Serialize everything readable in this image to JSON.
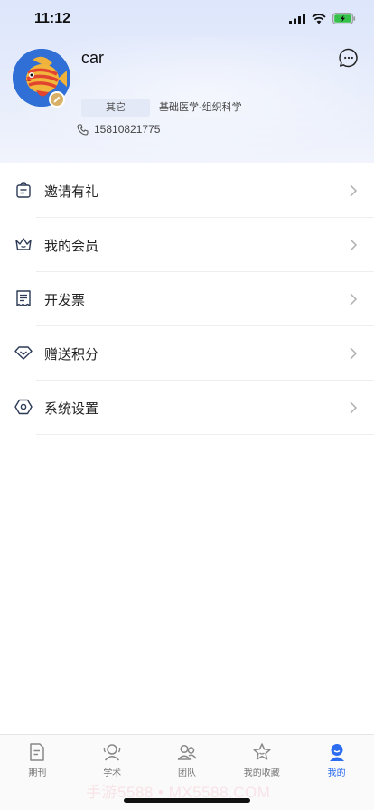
{
  "status_bar": {
    "time": "11:12"
  },
  "profile": {
    "username": "car",
    "tag": "其它",
    "major": "基础医学-组织科学",
    "phone": "15810821775"
  },
  "menu": [
    {
      "label": "邀请有礼",
      "icon": "gift-icon"
    },
    {
      "label": "我的会员",
      "icon": "crown-icon"
    },
    {
      "label": "开发票",
      "icon": "invoice-icon"
    },
    {
      "label": "赠送积分",
      "icon": "diamond-icon"
    },
    {
      "label": "系统设置",
      "icon": "settings-icon"
    }
  ],
  "tabs": [
    {
      "label": "期刊",
      "icon": "journal-icon",
      "active": false
    },
    {
      "label": "学术",
      "icon": "academic-icon",
      "active": false
    },
    {
      "label": "团队",
      "icon": "team-icon",
      "active": false
    },
    {
      "label": "我的收藏",
      "icon": "star-icon",
      "active": false
    },
    {
      "label": "我的",
      "icon": "profile-icon",
      "active": true
    }
  ],
  "watermark": "手游5588 • MX5588.COM",
  "colors": {
    "accent": "#2b6cf0",
    "header_bg": "#dde6fb"
  }
}
